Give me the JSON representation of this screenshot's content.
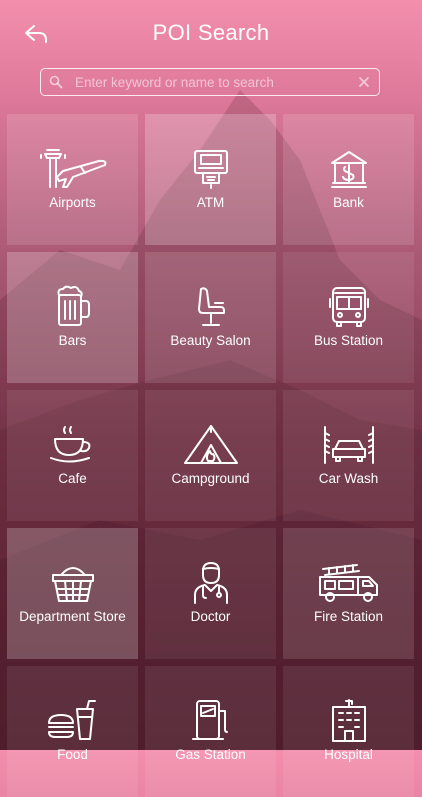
{
  "header": {
    "title": "POI Search",
    "back_icon": "back-arrow-icon"
  },
  "search": {
    "placeholder": "Enter keyword or name to search",
    "value": "",
    "icon": "search-icon",
    "clear_icon": "clear-icon"
  },
  "categories": [
    {
      "label": "Airports",
      "icon": "airport-icon"
    },
    {
      "label": "ATM",
      "icon": "atm-icon"
    },
    {
      "label": "Bank",
      "icon": "bank-icon"
    },
    {
      "label": "Bars",
      "icon": "beer-mug-icon"
    },
    {
      "label": "Beauty Salon",
      "icon": "salon-chair-icon"
    },
    {
      "label": "Bus Station",
      "icon": "bus-icon"
    },
    {
      "label": "Cafe",
      "icon": "coffee-cup-icon"
    },
    {
      "label": "Campground",
      "icon": "tent-icon"
    },
    {
      "label": "Car Wash",
      "icon": "car-wash-icon"
    },
    {
      "label": "Department Store",
      "icon": "shopping-basket-icon"
    },
    {
      "label": "Doctor",
      "icon": "doctor-icon"
    },
    {
      "label": "Fire Station",
      "icon": "fire-truck-icon"
    },
    {
      "label": "Food",
      "icon": "fast-food-icon"
    },
    {
      "label": "Gas Station",
      "icon": "gas-pump-icon"
    },
    {
      "label": "Hospital",
      "icon": "hospital-icon"
    }
  ]
}
